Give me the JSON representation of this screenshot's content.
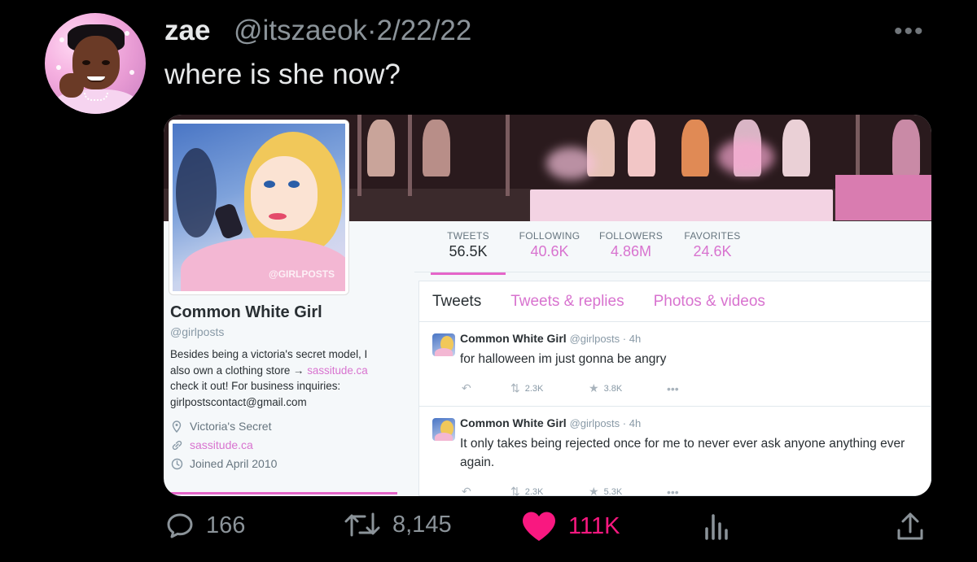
{
  "tweet": {
    "author_name": "zae",
    "author_handle_date": "@itszaeok·2/22/22",
    "text": "where is she now?",
    "more_icon": "more-horizontal-icon",
    "more_glyph": "•••"
  },
  "embedded": {
    "profile": {
      "name": "Common White Girl",
      "handle": "@girlposts",
      "watermark": "@GIRLPOSTS",
      "bio_line1": "Besides being a victoria's secret model, I",
      "bio_line2": "also own a clothing store → ",
      "bio_link": "sassitude.ca",
      "bio_line3": "check it out! For business inquiries:",
      "bio_line4": "girlpostscontact@gmail.com",
      "location": "Victoria's Secret",
      "website": "sassitude.ca",
      "joined": "Joined April 2010"
    },
    "stats": [
      {
        "label": "TWEETS",
        "value": "56.5K"
      },
      {
        "label": "FOLLOWING",
        "value": "40.6K"
      },
      {
        "label": "FOLLOWERS",
        "value": "4.86M"
      },
      {
        "label": "FAVORITES",
        "value": "24.6K"
      }
    ],
    "tabs": [
      "Tweets",
      "Tweets & replies",
      "Photos & videos"
    ],
    "tweets": [
      {
        "name": "Common White Girl",
        "meta": "@girlposts · 4h",
        "text": "for halloween im just gonna be angry",
        "retweets": "2.3K",
        "favorites": "3.8K"
      },
      {
        "name": "Common White Girl",
        "meta": "@girlposts · 4h",
        "text": "It only takes being rejected once for me to never ever ask anyone anything ever again.",
        "retweets": "2.3K",
        "favorites": "5.3K"
      }
    ],
    "accent_color": "#d873cf"
  },
  "footer": {
    "replies": "166",
    "retweets": "8,145",
    "likes": "111K",
    "like_color": "#f91880"
  }
}
